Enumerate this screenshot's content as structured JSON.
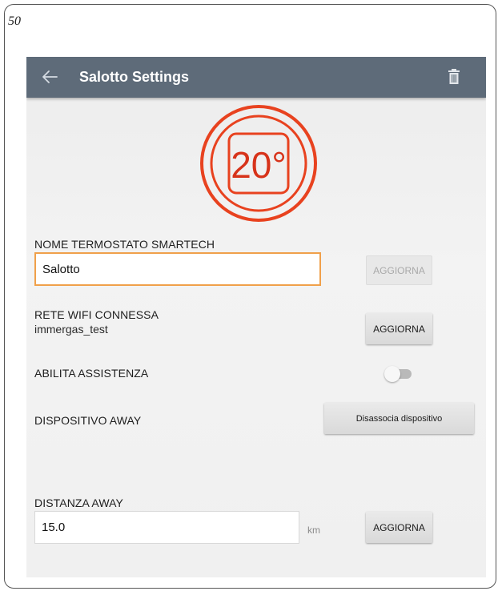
{
  "page": {
    "number": "50"
  },
  "appbar": {
    "title": "Salotto Settings",
    "back_icon": "arrow-left-icon",
    "delete_icon": "trash-icon",
    "background": "#5e6b79"
  },
  "thermostat_logo": {
    "temperature": "20°",
    "accent": "#e8421f"
  },
  "name_section": {
    "label": "NOME TERMOSTATO SMARTECH",
    "input_value": "Salotto",
    "update_label": "AGGIORNA",
    "update_disabled": true
  },
  "wifi_section": {
    "label": "RETE WIFI CONNESSA",
    "network": "immergas_test",
    "update_label": "AGGIORNA"
  },
  "assistance_section": {
    "label": "ABILITA ASSISTENZA",
    "enabled": false
  },
  "away_device_section": {
    "label": "DISPOSITIVO AWAY",
    "button_label": "Disassocia dispositivo"
  },
  "distance_section": {
    "label": "DISTANZA AWAY",
    "input_value": "15.0",
    "unit": "km",
    "update_label": "AGGIORNA"
  }
}
